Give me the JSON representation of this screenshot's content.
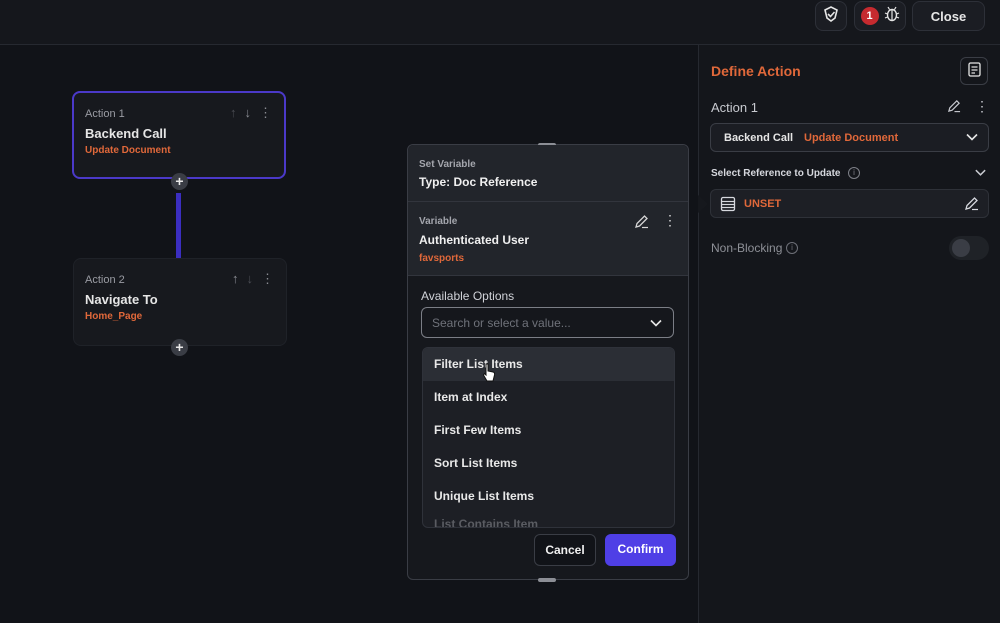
{
  "topbar": {
    "badge_count": "1",
    "close_label": "Close"
  },
  "actions": [
    {
      "index_label": "Action 1",
      "title": "Backend Call",
      "subtitle": "Update Document"
    },
    {
      "index_label": "Action 2",
      "title": "Navigate To",
      "subtitle": "Home_Page"
    }
  ],
  "modal": {
    "set_variable_label": "Set Variable",
    "type_label": "Type: Doc Reference",
    "variable_label": "Variable",
    "variable_value": "Authenticated User",
    "variable_field": "favsports",
    "available_options_label": "Available Options",
    "search_placeholder": "Search or select a value...",
    "options": [
      "Filter List Items",
      "Item at Index",
      "First Few Items",
      "Sort List Items",
      "Unique List Items",
      "List Contains Item"
    ],
    "cancel_label": "Cancel",
    "confirm_label": "Confirm"
  },
  "define_action": {
    "title": "Define Action",
    "action_label": "Action 1",
    "call_type": "Backend Call",
    "call_name": "Update Document",
    "reference_label": "Select Reference to Update",
    "reference_value": "UNSET",
    "non_blocking_label": "Non-Blocking",
    "non_blocking_on": false
  },
  "colors": {
    "accent_orange": "#e0683a",
    "accent_purple": "#4f3fe6",
    "badge_red": "#c62a2f"
  }
}
